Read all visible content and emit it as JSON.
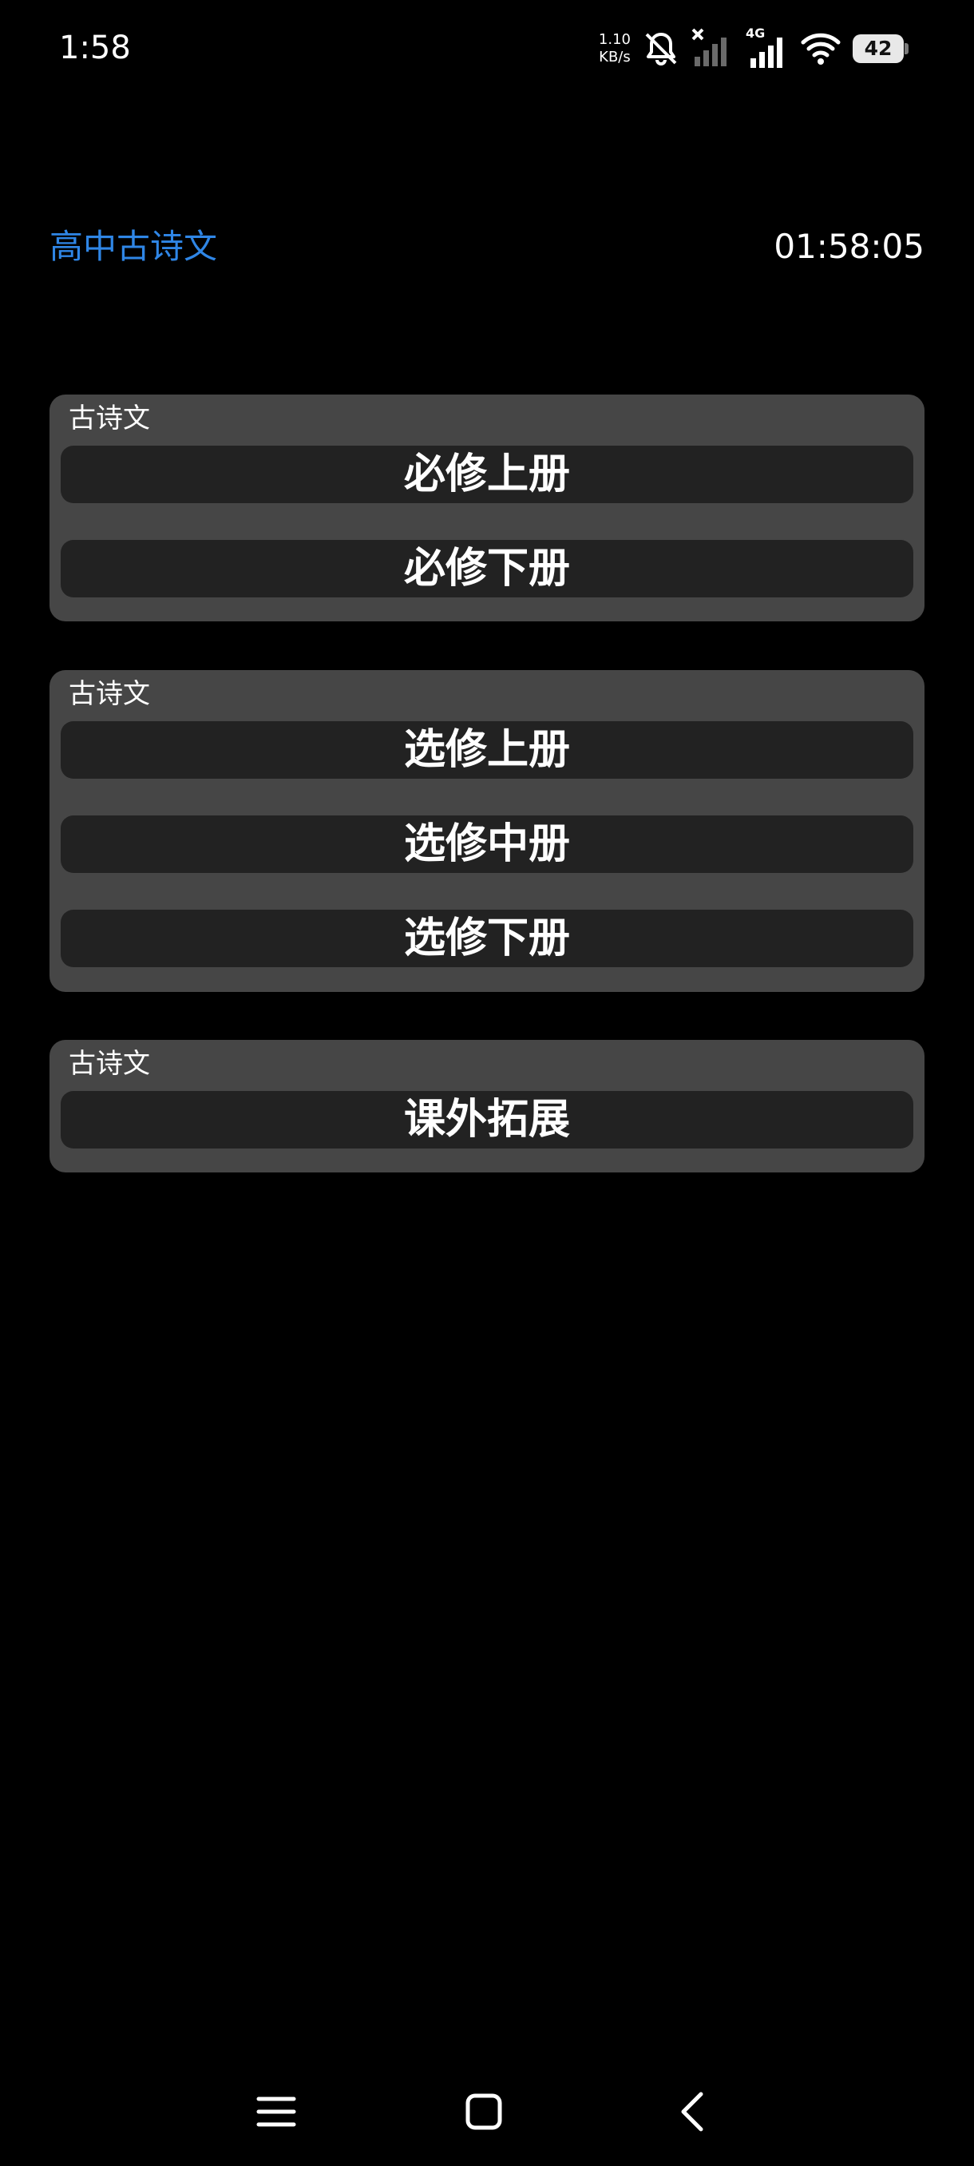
{
  "status_bar": {
    "time": "1:58",
    "net_speed_value": "1.10",
    "net_speed_unit": "KB/s",
    "network_type": "4G",
    "battery_level": "42"
  },
  "header": {
    "title": "高中古诗文",
    "clock": "01:58:05"
  },
  "groups": [
    {
      "label": "古诗文",
      "buttons": [
        "必修上册",
        "必修下册"
      ]
    },
    {
      "label": "古诗文",
      "buttons": [
        "选修上册",
        "选修中册",
        "选修下册"
      ]
    },
    {
      "label": "古诗文",
      "buttons": [
        "课外拓展"
      ]
    }
  ],
  "colors": {
    "accent": "#2f86e6",
    "background": "#000000",
    "group_bg": "#464646",
    "button_bg": "#222222"
  },
  "nav_bar": {
    "icons": [
      "menu-icon",
      "home-icon",
      "back-icon"
    ]
  }
}
